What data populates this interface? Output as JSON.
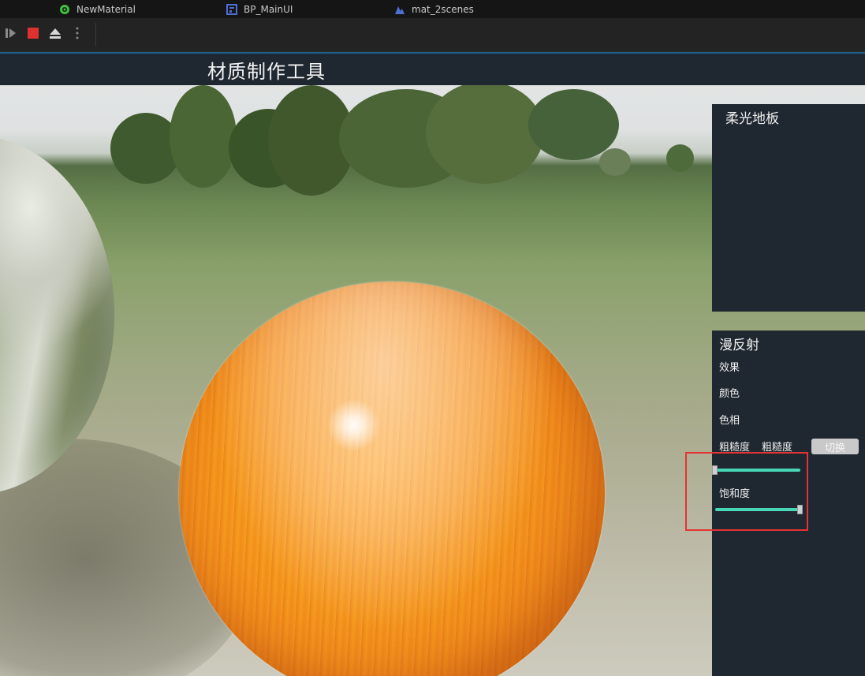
{
  "editor": {
    "tabs": [
      {
        "label": "NewMaterial",
        "icon": "material-icon",
        "color": "#3fbf3f"
      },
      {
        "label": "BP_MainUI",
        "icon": "widget-blueprint-icon",
        "color": "#4d6fd1"
      },
      {
        "label": "mat_2scenes",
        "icon": "level-icon",
        "color": "#4d6fd1"
      }
    ],
    "toolbar": {
      "play": "play-icon",
      "stop": "stop-icon",
      "eject": "eject-icon",
      "more": "more-options-icon",
      "stop_color": "#e03131"
    }
  },
  "ui": {
    "title": "材质制作工具",
    "soft_light_panel": {
      "title": "柔光地板"
    },
    "diffuse_panel": {
      "title": "漫反射",
      "effect_label": "效果",
      "color_label": "颜色",
      "hue_label": "色相",
      "roughness_label": "粗糙度",
      "roughness_value_label": "粗糙度",
      "switch_button": "切换",
      "saturation_label": "饱和度",
      "roughness_slider_value": 0.0,
      "saturation_slider_value": 1.0,
      "slider_color": "#47d6b6"
    },
    "highlight_color": "#e53333"
  }
}
